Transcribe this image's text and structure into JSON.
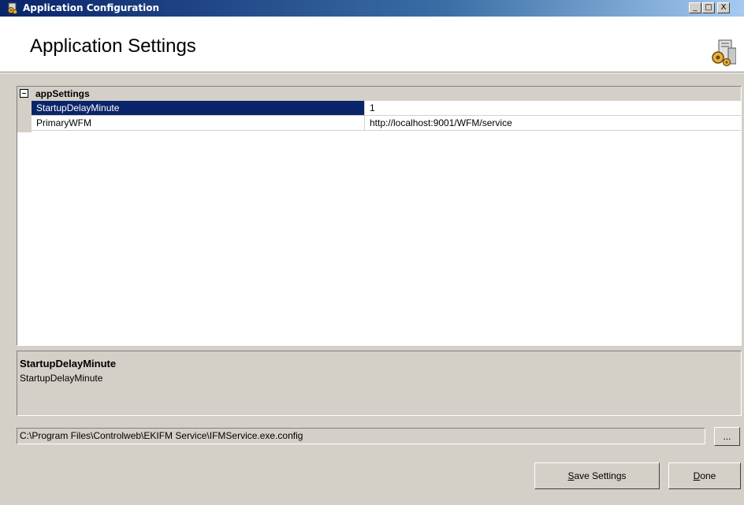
{
  "window": {
    "title": "Application Configuration",
    "controls": {
      "minimize": "_",
      "maximize": "□",
      "close": "X"
    },
    "icon": "config-app-icon"
  },
  "header": {
    "heading": "Application Settings",
    "icon": "config-settings-icon"
  },
  "property_grid": {
    "category": {
      "label": "appSettings",
      "expanded": true
    },
    "rows": [
      {
        "name": "StartupDelayMinute",
        "value": "1",
        "selected": true
      },
      {
        "name": "PrimaryWFM",
        "value": "http://localhost:9001/WFM/service",
        "selected": false
      }
    ]
  },
  "description": {
    "title": "StartupDelayMinute",
    "text": "StartupDelayMinute"
  },
  "config_path": {
    "value": "C:\\Program Files\\Controlweb\\EKIFM Service\\IFMService.exe.config"
  },
  "buttons": {
    "browse_label": "...",
    "save_mnemonic": "S",
    "save_rest": "ave Settings",
    "done_mnemonic": "D",
    "done_rest": "one"
  },
  "colors": {
    "titlebar_start": "#0a246a",
    "titlebar_end": "#a6caf0",
    "selection": "#0a246a",
    "face": "#d4d0c8"
  }
}
